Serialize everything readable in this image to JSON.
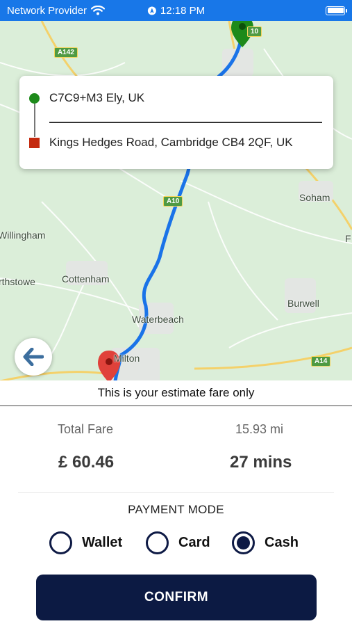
{
  "status_bar": {
    "carrier": "Network Provider",
    "time": "12:18 PM",
    "icons": [
      "wifi-icon",
      "location-arrow-icon",
      "battery-icon"
    ],
    "background_color": "#1877e8"
  },
  "map": {
    "place_labels": [
      "Soham",
      "Willingham",
      "Cottenham",
      "rthstowe",
      "Burwell",
      "Waterbeach",
      "Milton",
      "F"
    ],
    "road_labels": [
      "A142",
      "A10",
      "A14",
      "10"
    ],
    "route_color": "#1a73e8",
    "start_pin_color": "#1d8a1a",
    "end_pin_color": "#e0413a"
  },
  "trip": {
    "pickup": "C7C9+M3 Ely, UK",
    "dropoff": "Kings Hedges Road, Cambridge CB4 2QF, UK"
  },
  "sheet": {
    "estimate_note": "This is your estimate fare only",
    "total_fare_label": "Total Fare",
    "total_fare_value": "£ 60.46",
    "distance": "15.93 mi",
    "duration": "27 mins",
    "payment_mode_title": "PAYMENT MODE",
    "payment_options": [
      {
        "label": "Wallet",
        "selected": false
      },
      {
        "label": "Card",
        "selected": false
      },
      {
        "label": "Cash",
        "selected": true
      }
    ],
    "confirm_label": "CONFIRM"
  },
  "colors": {
    "primary_dark": "#0c1a43",
    "map_background": "#dbeed9"
  }
}
